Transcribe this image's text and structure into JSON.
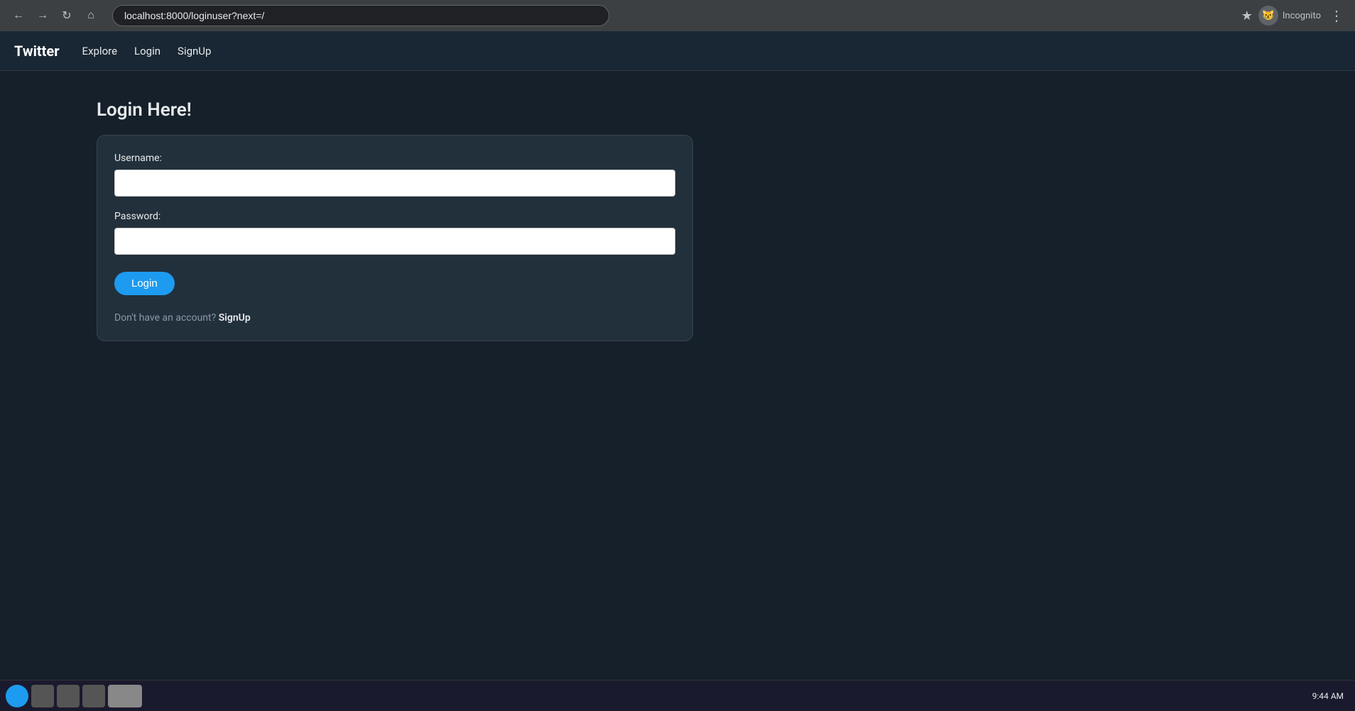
{
  "browser": {
    "url": "localhost:8000/loginuser?next=/",
    "incognito_label": "Incognito"
  },
  "navbar": {
    "brand": "Twitter",
    "links": [
      {
        "label": "Explore",
        "href": "#"
      },
      {
        "label": "Login",
        "href": "#"
      },
      {
        "label": "SignUp",
        "href": "#"
      }
    ]
  },
  "page": {
    "title": "Login Here!",
    "form": {
      "username_label": "Username:",
      "username_placeholder": "",
      "password_label": "Password:",
      "password_placeholder": "",
      "login_button": "Login",
      "no_account_text": "Don't have an account?",
      "signup_link": "SignUp"
    }
  },
  "taskbar": {
    "time": "9:44 AM"
  }
}
